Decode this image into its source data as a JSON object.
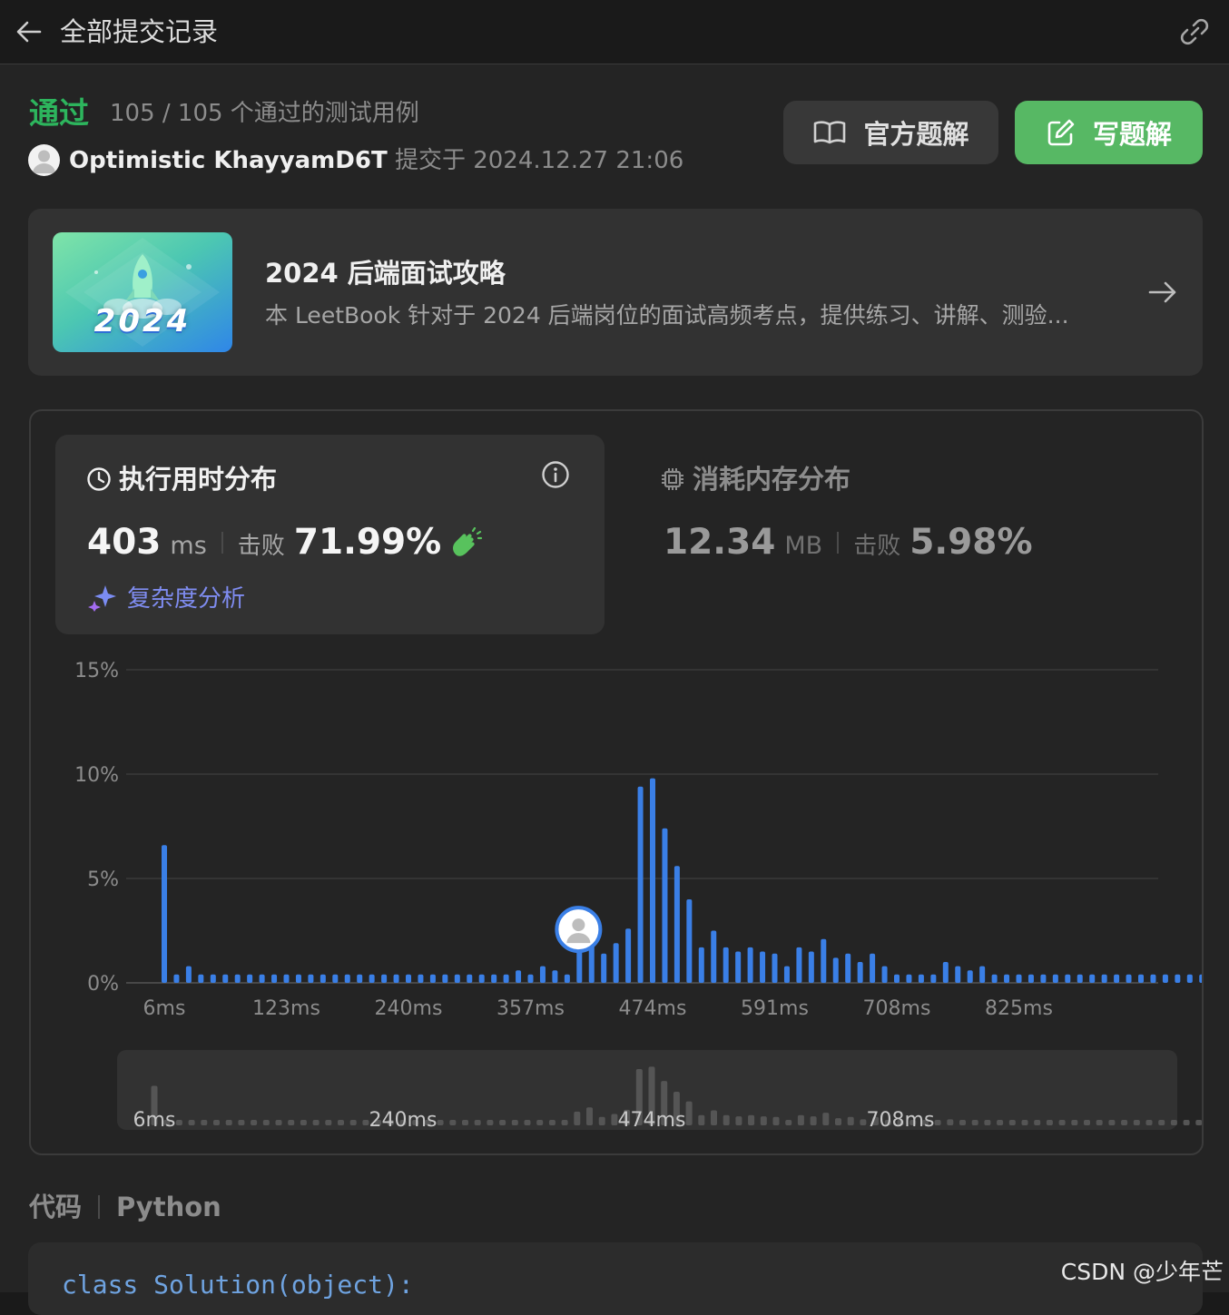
{
  "header": {
    "title": "全部提交记录",
    "back_icon": "arrow-left-icon",
    "link_icon": "link-icon"
  },
  "submission": {
    "status": "通过",
    "cases": "105 / 105 个通过的测试用例",
    "username": "Optimistic KhayyamD6T",
    "submitted_text": "提交于 2024.12.27 21:06"
  },
  "buttons": {
    "official_solution": "官方题解",
    "write_solution": "写题解"
  },
  "promo": {
    "image_text": "2024",
    "title": "2024 后端面试攻略",
    "description": "本 LeetBook 针对于 2024 后端岗位的面试高频考点，提供练习、讲解、测验..."
  },
  "runtime": {
    "title": "执行用时分布",
    "value": "403",
    "unit": "ms",
    "beat_label": "击败",
    "beat_value": "71.99%",
    "analysis_label": "复杂度分析"
  },
  "memory": {
    "title": "消耗内存分布",
    "value": "12.34",
    "unit": "MB",
    "beat_label": "击败",
    "beat_value": "5.98%"
  },
  "chart_data": {
    "type": "bar",
    "x_unit": "ms",
    "x_start": 6,
    "x_step": 11.7,
    "yticks": [
      "15%",
      "10%",
      "5%",
      "0%"
    ],
    "ylim": [
      0,
      15
    ],
    "xtick_labels": [
      "6ms",
      "123ms",
      "240ms",
      "357ms",
      "474ms",
      "591ms",
      "708ms",
      "825ms"
    ],
    "navigator_labels": [
      "6ms",
      "240ms",
      "474ms",
      "708ms"
    ],
    "highlight_x": 403,
    "values": [
      6.6,
      0.4,
      0.8,
      0.4,
      0.4,
      0.4,
      0.4,
      0.4,
      0.4,
      0.4,
      0.4,
      0.4,
      0.4,
      0.4,
      0.4,
      0.4,
      0.4,
      0.4,
      0.4,
      0.4,
      0.4,
      0.4,
      0.4,
      0.4,
      0.4,
      0.4,
      0.4,
      0.4,
      0.4,
      0.6,
      0.4,
      0.8,
      0.6,
      0.4,
      2.3,
      3.0,
      1.4,
      1.9,
      2.6,
      9.4,
      9.8,
      7.4,
      5.6,
      4.0,
      1.7,
      2.5,
      1.7,
      1.5,
      1.7,
      1.5,
      1.4,
      0.8,
      1.7,
      1.5,
      2.1,
      1.2,
      1.4,
      1.0,
      1.4,
      0.8,
      0.4,
      0.4,
      0.4,
      0.4,
      1.0,
      0.8,
      0.6,
      0.8,
      0.4,
      0.4,
      0.4,
      0.4,
      0.4,
      0.4,
      0.4,
      0.4,
      0.4,
      0.4,
      0.4,
      0.4,
      0.4,
      0.4,
      0.4,
      0.4,
      0.4,
      0.4
    ]
  },
  "code": {
    "label": "代码",
    "language": "Python",
    "first_line": "class Solution(object):"
  },
  "watermark": "CSDN @少年芒"
}
